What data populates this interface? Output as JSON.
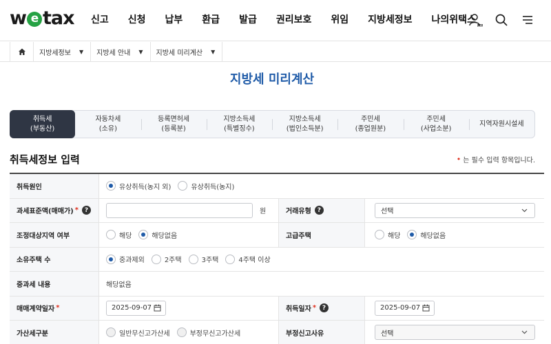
{
  "header": {
    "logo_text_left": "w",
    "logo_text_e": "e",
    "logo_text_right": "tax",
    "nav": [
      "신고",
      "신청",
      "납부",
      "환급",
      "발급",
      "권리보호",
      "위임",
      "지방세정보",
      "나의위택스"
    ],
    "icons": [
      "my-user-icon",
      "search-icon",
      "menu-icon"
    ]
  },
  "breadcrumb": {
    "home_icon": "home-icon",
    "items": [
      "지방세정보",
      "지방세 안내",
      "지방세 미리계산"
    ]
  },
  "page_title": "지방세 미리계산",
  "tabs": [
    {
      "label": "취득세\n(부동산)",
      "active": true
    },
    {
      "label": "자동차세\n(소유)",
      "active": false
    },
    {
      "label": "등록면허세\n(등록분)",
      "active": false
    },
    {
      "label": "지방소득세\n(특별징수)",
      "active": false
    },
    {
      "label": "지방소득세\n(법인소득분)",
      "active": false
    },
    {
      "label": "주민세\n(종업원분)",
      "active": false
    },
    {
      "label": "주민세\n(사업소분)",
      "active": false
    },
    {
      "label": "지역자원시설세",
      "active": false
    }
  ],
  "section": {
    "title": "취득세정보 입력",
    "required_note": "는 필수 입력 항목입니다."
  },
  "form": {
    "acq_cause": {
      "label": "취득원인",
      "options": [
        "유상취득(농지 외)",
        "유상취득(농지)"
      ],
      "selected": 0
    },
    "tax_base": {
      "label": "과세표준액(매매가)",
      "value": "",
      "unit": "원"
    },
    "deal_type": {
      "label": "거래유형",
      "value": "선택"
    },
    "adjusted_area": {
      "label": "조정대상지역 여부",
      "options": [
        "해당",
        "해당없음"
      ],
      "selected": 1
    },
    "luxury_house": {
      "label": "고급주택",
      "options": [
        "해당",
        "해당없음"
      ],
      "selected": 1
    },
    "houses_owned": {
      "label": "소유주택 수",
      "options": [
        "중과제외",
        "2주택",
        "3주택",
        "4주택 이상"
      ],
      "selected": 0
    },
    "heavy_tax": {
      "label": "중과세 내용",
      "value": "해당없음"
    },
    "contract_date": {
      "label": "매매계약일자",
      "value": "2025-09-07"
    },
    "acq_date": {
      "label": "취득일자",
      "value": "2025-09-07"
    },
    "penalty_type": {
      "label": "가산세구분",
      "options": [
        "일반무신고가산세",
        "부정무신고가산세"
      ],
      "selected": -1
    },
    "fraud_reason": {
      "label": "부정신고사유",
      "value": "선택"
    }
  },
  "colors": {
    "accent": "#1f5ba8",
    "tab_active_bg": "#2f3644",
    "required": "#e0301e",
    "logo_green": "#26a244"
  }
}
